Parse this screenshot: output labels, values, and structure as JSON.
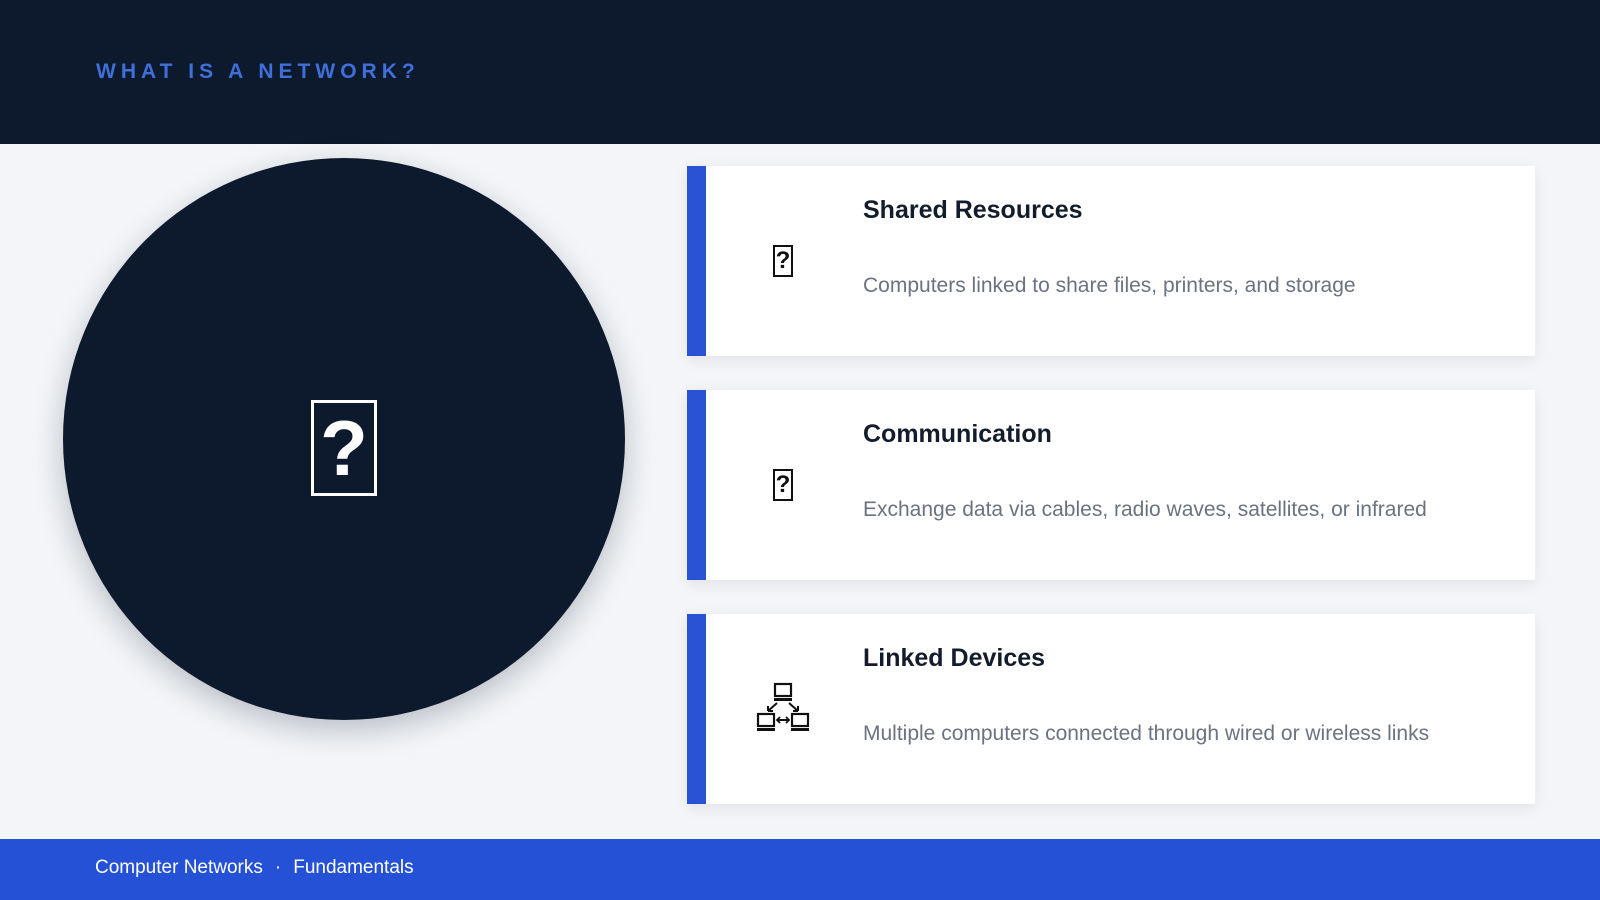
{
  "header": {
    "title": "WHAT IS A NETWORK?"
  },
  "hero": {
    "icon": "missing-glyph-icon",
    "glyph": "?"
  },
  "cards": [
    {
      "title": "Shared Resources",
      "description": "Computers linked to share files, printers, and storage",
      "icon": "missing-glyph-icon",
      "glyph": "?"
    },
    {
      "title": "Communication",
      "description": "Exchange data via cables, radio waves, satellites, or infrared",
      "icon": "missing-glyph-icon",
      "glyph": "?"
    },
    {
      "title": "Linked Devices",
      "description": "Multiple computers connected through wired or wireless links",
      "icon": "network-computers-icon"
    }
  ],
  "footer": {
    "course": "Computer Networks",
    "separator": "·",
    "section": "Fundamentals"
  },
  "colors": {
    "header_bg": "#0d1a2d",
    "accent": "#2a52d4",
    "footer_bg": "#2451d6",
    "title_text": "#3f6fd8",
    "page_bg": "#f3f5f8"
  }
}
